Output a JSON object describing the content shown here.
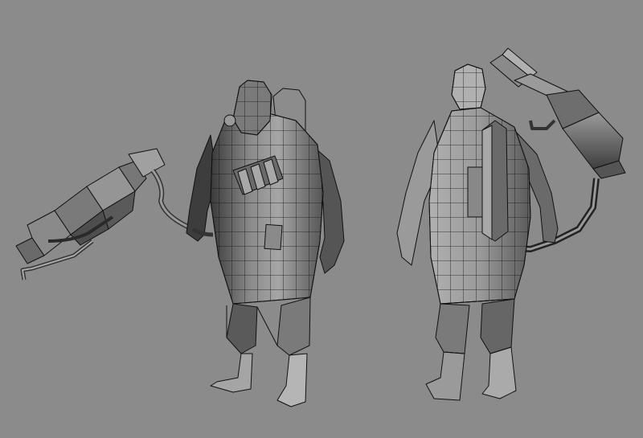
{
  "scene": {
    "background": "#8b8b8b",
    "wire_color": "#111111",
    "shade_light": "#a9a9a9",
    "shade_mid": "#6d6d6d",
    "shade_dark": "#2e2e2e",
    "subjects": [
      {
        "name": "front-view",
        "parts": [
          "gas-mask-head",
          "torso",
          "ammo-pouch",
          "arms",
          "legs",
          "boots",
          "hose",
          "flamethrower"
        ]
      },
      {
        "name": "back-view",
        "parts": [
          "head",
          "torso",
          "fuel-tank",
          "arms",
          "legs",
          "boots",
          "hose",
          "flamethrower"
        ]
      }
    ]
  }
}
